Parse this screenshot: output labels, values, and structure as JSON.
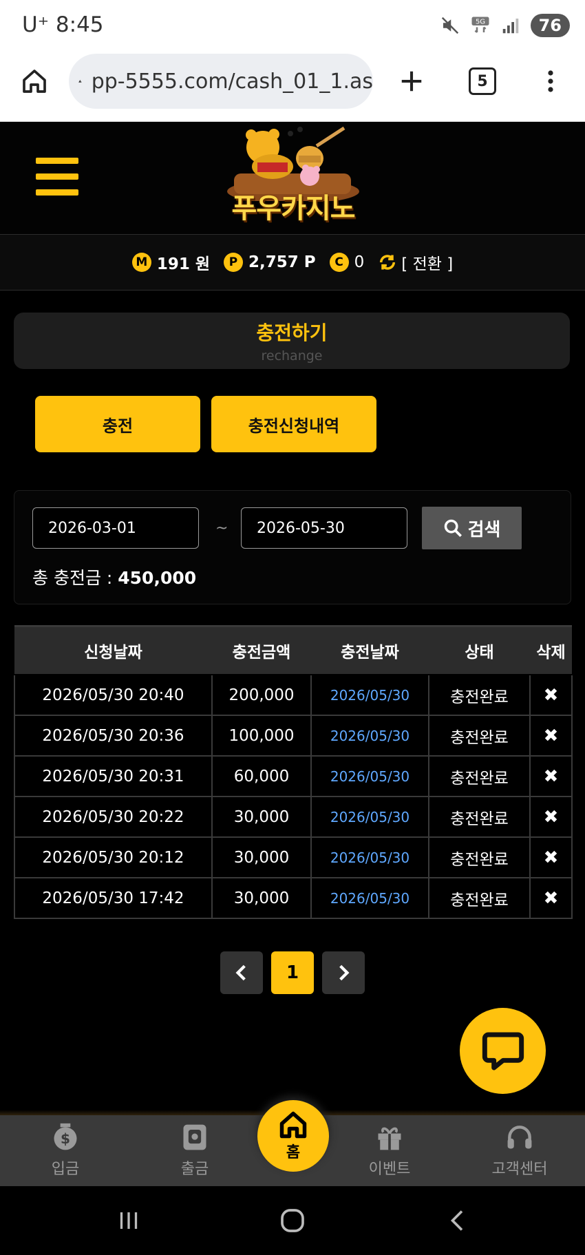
{
  "status_bar": {
    "carrier": "U⁺ 8:45",
    "battery": "76"
  },
  "browser": {
    "url": "pp-5555.com/cash_01_1.as",
    "tab_count": "5"
  },
  "site": {
    "logo_text": "푸우카지노"
  },
  "balance": {
    "money": "191 원",
    "money_icon": "M",
    "points": "2,757 P",
    "points_icon": "P",
    "coins": "0",
    "coins_icon": "C",
    "convert_label": "[ 전환 ]"
  },
  "page": {
    "title": "충전하기",
    "subtitle": "rechange"
  },
  "tabs": [
    {
      "label": "충전"
    },
    {
      "label": "충전신청내역"
    }
  ],
  "search": {
    "start_date": "2026-03-01",
    "end_date": "2026-05-30",
    "separator": "~",
    "button_label": "검색",
    "total_label": "총 충전금 : ",
    "total_value": "450,000"
  },
  "table": {
    "headers": [
      "신청날짜",
      "충전금액",
      "충전날짜",
      "상태",
      "삭제"
    ],
    "rows": [
      {
        "request_date": "2026/05/30 20:40",
        "amount": "200,000",
        "charge_date": "2026/05/30",
        "status": "충전완료",
        "delete": "✖"
      },
      {
        "request_date": "2026/05/30 20:36",
        "amount": "100,000",
        "charge_date": "2026/05/30",
        "status": "충전완료",
        "delete": "✖"
      },
      {
        "request_date": "2026/05/30 20:31",
        "amount": "60,000",
        "charge_date": "2026/05/30",
        "status": "충전완료",
        "delete": "✖"
      },
      {
        "request_date": "2026/05/30 20:22",
        "amount": "30,000",
        "charge_date": "2026/05/30",
        "status": "충전완료",
        "delete": "✖"
      },
      {
        "request_date": "2026/05/30 20:12",
        "amount": "30,000",
        "charge_date": "2026/05/30",
        "status": "충전완료",
        "delete": "✖"
      },
      {
        "request_date": "2026/05/30 17:42",
        "amount": "30,000",
        "charge_date": "2026/05/30",
        "status": "충전완료",
        "delete": "✖"
      }
    ]
  },
  "pagination": {
    "prev": "‹",
    "current": "1",
    "next": "›"
  },
  "bottom_nav": {
    "deposit": "입금",
    "withdraw": "출금",
    "home": "홈",
    "event": "이벤트",
    "support": "고객센터"
  },
  "colors": {
    "accent": "#ffc20e",
    "link_blue": "#5fa8ff",
    "panel": "#1e1e1e"
  }
}
